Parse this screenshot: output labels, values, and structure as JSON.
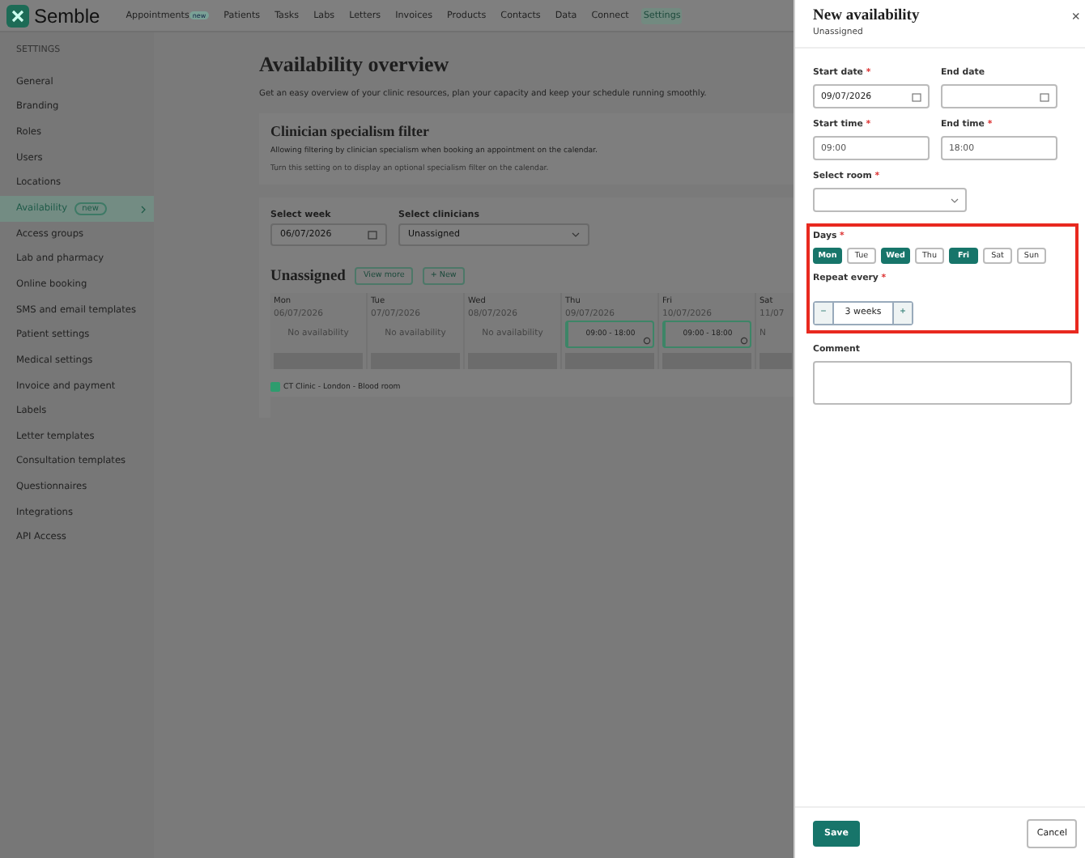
{
  "top_nav": {
    "logo": "Semble",
    "items": [
      {
        "label": "Appointments",
        "badge": "new",
        "selected": false
      },
      {
        "label": "Patients",
        "selected": false
      },
      {
        "label": "Tasks",
        "selected": false
      },
      {
        "label": "Labs",
        "selected": false
      },
      {
        "label": "Letters",
        "selected": false
      },
      {
        "label": "Invoices",
        "selected": false
      },
      {
        "label": "Products",
        "selected": false
      },
      {
        "label": "Contacts",
        "selected": false
      },
      {
        "label": "Data",
        "selected": false
      },
      {
        "label": "Connect",
        "selected": false
      },
      {
        "label": "Settings",
        "selected": true
      }
    ]
  },
  "sidebar": {
    "heading": "SETTINGS",
    "items": [
      {
        "label": "General",
        "selected": false
      },
      {
        "label": "Branding",
        "selected": false
      },
      {
        "label": "Roles",
        "selected": false
      },
      {
        "label": "Users",
        "selected": false
      },
      {
        "label": "Locations",
        "selected": false
      },
      {
        "label": "Availability",
        "badge": "new",
        "selected": true
      },
      {
        "label": "Access groups",
        "selected": false
      },
      {
        "label": "Lab and pharmacy",
        "selected": false
      },
      {
        "label": "Online booking",
        "selected": false
      },
      {
        "label": "SMS and email templates",
        "selected": false
      },
      {
        "label": "Patient settings",
        "selected": false
      },
      {
        "label": "Medical settings",
        "selected": false
      },
      {
        "label": "Invoice and payment",
        "selected": false
      },
      {
        "label": "Labels",
        "selected": false
      },
      {
        "label": "Letter templates",
        "selected": false
      },
      {
        "label": "Consultation templates",
        "selected": false
      },
      {
        "label": "Questionnaires",
        "selected": false
      },
      {
        "label": "Integrations",
        "selected": false
      },
      {
        "label": "API Access",
        "selected": false
      }
    ]
  },
  "main": {
    "title": "Availability overview",
    "description": "Get an easy overview of your clinic resources, plan your capacity and keep your schedule running smoothly.",
    "filter_card": {
      "title": "Clinician specialism filter",
      "text": "Allowing filtering by clinician specialism when booking an appointment on the calendar.",
      "hint": "Turn this setting on to display an optional specialism filter on the calendar."
    },
    "select_week": {
      "label": "Select week",
      "value": "06/07/2026"
    },
    "select_clinicians": {
      "label": "Select clinicians",
      "value": "Unassigned"
    },
    "section_title": "Unassigned",
    "view_more": "View more",
    "new_button": "+ New",
    "days": [
      {
        "day": "Mon",
        "date": "06/07/2026",
        "slot": "No availability",
        "kind": "empty"
      },
      {
        "day": "Tue",
        "date": "07/07/2026",
        "slot": "No availability",
        "kind": "empty"
      },
      {
        "day": "Wed",
        "date": "08/07/2026",
        "slot": "No availability",
        "kind": "empty"
      },
      {
        "day": "Thu",
        "date": "09/07/2026",
        "slot": "09:00 - 18:00",
        "kind": "slot"
      },
      {
        "day": "Fri",
        "date": "10/07/2026",
        "slot": "09:00 - 18:00",
        "kind": "slot"
      },
      {
        "day": "Sat",
        "date": "11/07",
        "slot": "N",
        "kind": "empty"
      }
    ],
    "room": {
      "label": "CT Clinic - London - Blood room",
      "color": "#2e9c6e"
    }
  },
  "drawer": {
    "title": "New availability",
    "subtitle": "Unassigned",
    "start_date": {
      "label": "Start date",
      "value": "09/07/2026"
    },
    "end_date": {
      "label": "End date"
    },
    "start_time": {
      "label": "Start time",
      "value": "09:00"
    },
    "end_time": {
      "label": "End time",
      "value": "18:00"
    },
    "room": {
      "label": "Select room"
    },
    "days_label": "Days",
    "days": [
      {
        "label": "Mon",
        "selected": true
      },
      {
        "label": "Tue",
        "selected": false
      },
      {
        "label": "Wed",
        "selected": true
      },
      {
        "label": "Thu",
        "selected": false
      },
      {
        "label": "Fri",
        "selected": true
      },
      {
        "label": "Sat",
        "selected": false
      },
      {
        "label": "Sun",
        "selected": false
      }
    ],
    "repeat_label": "Repeat every",
    "repeat_value": "3 weeks",
    "minus": "−",
    "plus": "+",
    "comment_label": "Comment",
    "save": "Save",
    "cancel": "Cancel",
    "close": "×",
    "required": "*"
  }
}
